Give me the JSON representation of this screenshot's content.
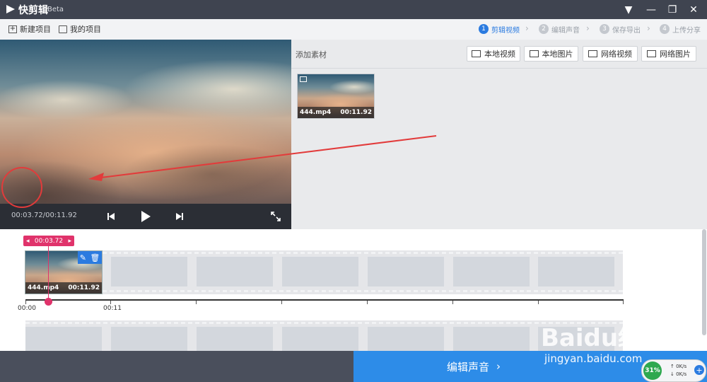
{
  "app": {
    "name": "快剪辑",
    "beta": "Beta"
  },
  "window_controls": [
    "menu",
    "minimize",
    "restore",
    "close"
  ],
  "toolbar": {
    "new_project": "新建项目",
    "my_projects": "我的项目"
  },
  "steps": [
    {
      "num": "1",
      "label": "剪辑视频",
      "active": true
    },
    {
      "num": "2",
      "label": "编辑声音",
      "active": false
    },
    {
      "num": "3",
      "label": "保存导出",
      "active": false
    },
    {
      "num": "4",
      "label": "上传分享",
      "active": false
    }
  ],
  "preview": {
    "time": "00:03.72/00:11.92"
  },
  "media_panel": {
    "title": "添加素材",
    "buttons": {
      "local_video": "本地视频",
      "local_image": "本地图片",
      "web_video": "网络视频",
      "web_image": "网络图片"
    },
    "items": [
      {
        "name": "444.mp4",
        "duration": "00:11.92"
      }
    ]
  },
  "timeline": {
    "playhead_time": "00:03.72",
    "clip": {
      "name": "444.mp4",
      "duration": "00:11.92"
    },
    "ruler_labels": [
      "00:00",
      "00:11"
    ]
  },
  "bottom": {
    "next_button": "编辑声音"
  },
  "watermark": {
    "line1": "Baidu经验",
    "line2": "jingyan.baidu.com"
  },
  "net_widget": {
    "percent": "31%",
    "up": "0K/s",
    "down": "0K/s"
  },
  "colors": {
    "accent": "#2b7be0",
    "playhead": "#e0336b",
    "next_button": "#2d8ce8",
    "annotation": "#e23b3b"
  }
}
